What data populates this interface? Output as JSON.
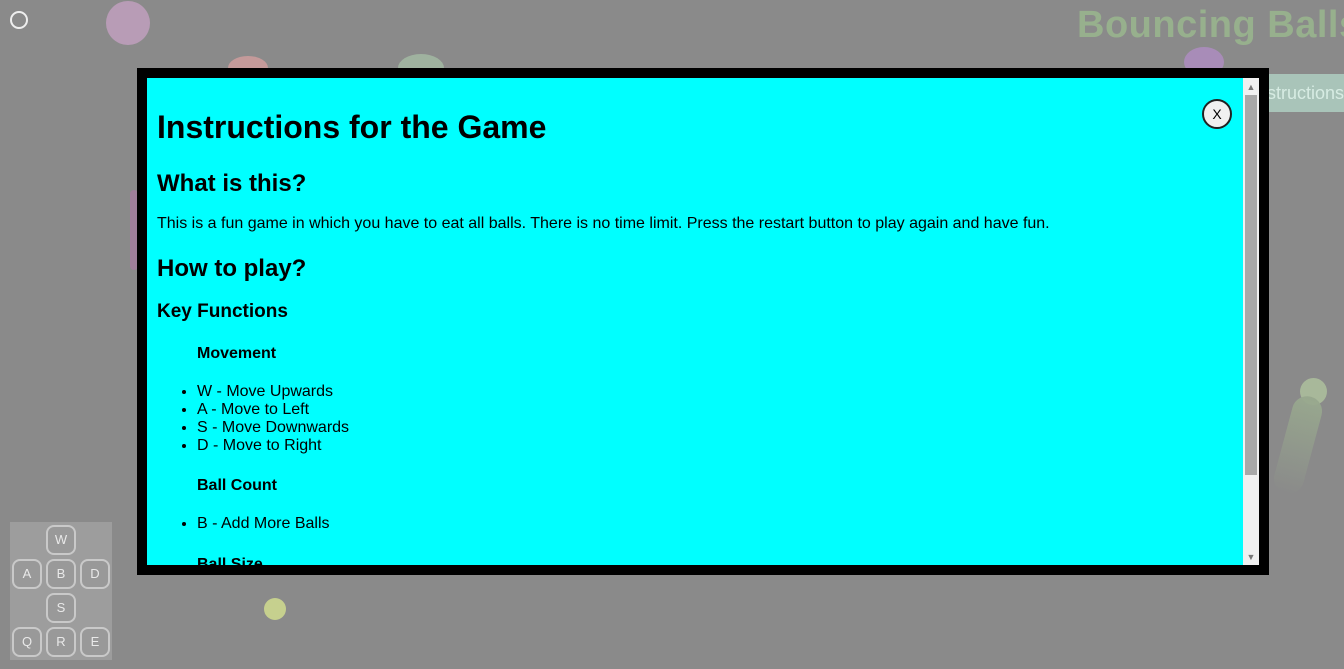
{
  "game": {
    "title": "Bouncing Balls",
    "instructions_button": "Instructions",
    "colors": {
      "overlay_background": "#8a8a8a",
      "modal_border": "#000000",
      "modal_background": "#00ffff"
    }
  },
  "keypad": {
    "w": "W",
    "a": "A",
    "b": "B",
    "d": "D",
    "s": "S",
    "q": "Q",
    "r": "R",
    "e": "E"
  },
  "modal": {
    "close_label": "X",
    "title": "Instructions for the Game",
    "what_heading": "What is this?",
    "what_text": "This is a fun game in which you have to eat all balls. There is no time limit. Press the restart button to play again and have fun.",
    "how_heading": "How to play?",
    "key_functions_heading": "Key Functions",
    "movement_heading": "Movement",
    "movement_items": [
      "W - Move Upwards",
      "A - Move to Left",
      "S - Move Downwards",
      "D - Move to Right"
    ],
    "ball_count_heading": "Ball Count",
    "ball_count_items": [
      "B - Add More Balls"
    ],
    "ball_size_heading": "Ball Size"
  },
  "scrollbar": {
    "up_icon": "▲",
    "down_icon": "▼"
  }
}
